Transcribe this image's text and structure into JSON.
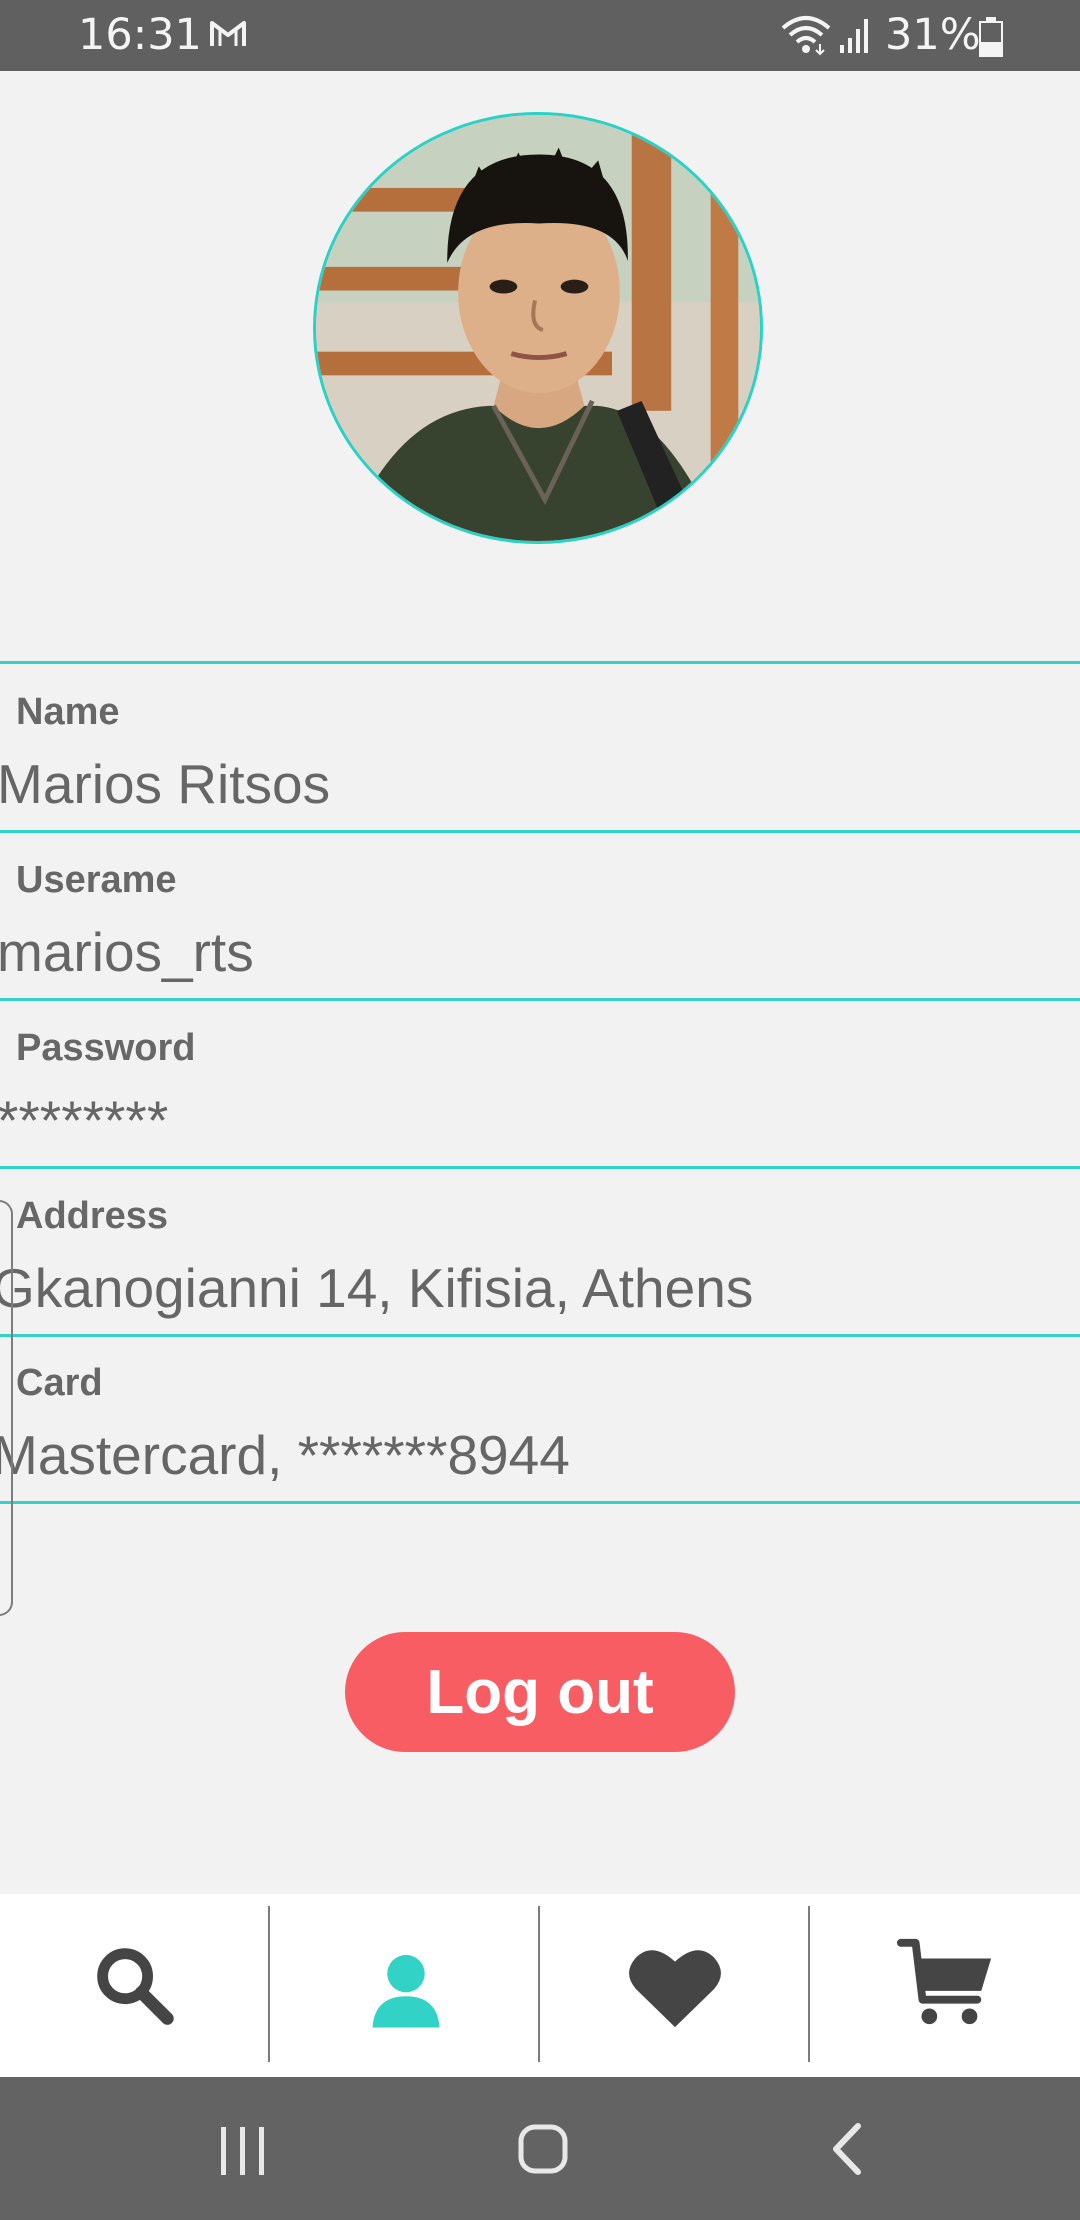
{
  "status_bar": {
    "time": "16:31",
    "battery": "31%",
    "icons": [
      "mail-icon",
      "wifi-icon",
      "signal-icon",
      "battery-icon"
    ]
  },
  "profile": {
    "fields": [
      {
        "label": "Name",
        "value": "Marios Ritsos"
      },
      {
        "label": "Userame",
        "value": "marios_rts"
      },
      {
        "label": "Password",
        "value": "********"
      },
      {
        "label": "Address",
        "value": "Gkanogianni 14, Kifisia, Athens"
      },
      {
        "label": "Card",
        "value": "Mastercard, *******8944"
      }
    ],
    "logout_label": "Log out"
  },
  "bottom_nav": {
    "items": [
      {
        "icon": "search-icon",
        "active": false
      },
      {
        "icon": "user-icon",
        "active": true
      },
      {
        "icon": "heart-icon",
        "active": false
      },
      {
        "icon": "cart-icon",
        "active": false
      }
    ]
  },
  "system_nav": {
    "icons": [
      "recent-apps-icon",
      "home-icon",
      "back-icon"
    ]
  },
  "colors": {
    "accent": "#33d2c7",
    "logout": "#f85d64",
    "text": "#666666",
    "icon": "#454545",
    "status_bar": "#606060",
    "system_nav": "#636363"
  }
}
